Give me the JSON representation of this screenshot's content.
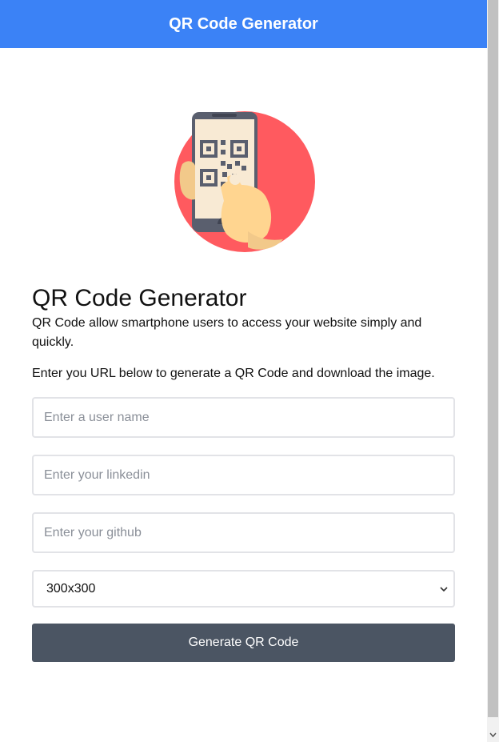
{
  "navbar": {
    "title": "QR Code Generator",
    "color": "#3b82f6"
  },
  "illustration": {
    "icon": "qr-phone-hand-illustration"
  },
  "main": {
    "heading": "QR Code Generator",
    "description": "QR Code allow smartphone users to access your website simply and quickly.",
    "instructions": "Enter you URL below to generate a QR Code and download the image."
  },
  "form": {
    "username_placeholder": "Enter a user name",
    "linkedin_placeholder": "Enter your linkedin",
    "github_placeholder": "Enter your github",
    "size_selected": "300x300",
    "generate_label": "Generate QR Code"
  },
  "colors": {
    "button": "#4b5563",
    "illustration_circle": "#ff5a5f"
  }
}
